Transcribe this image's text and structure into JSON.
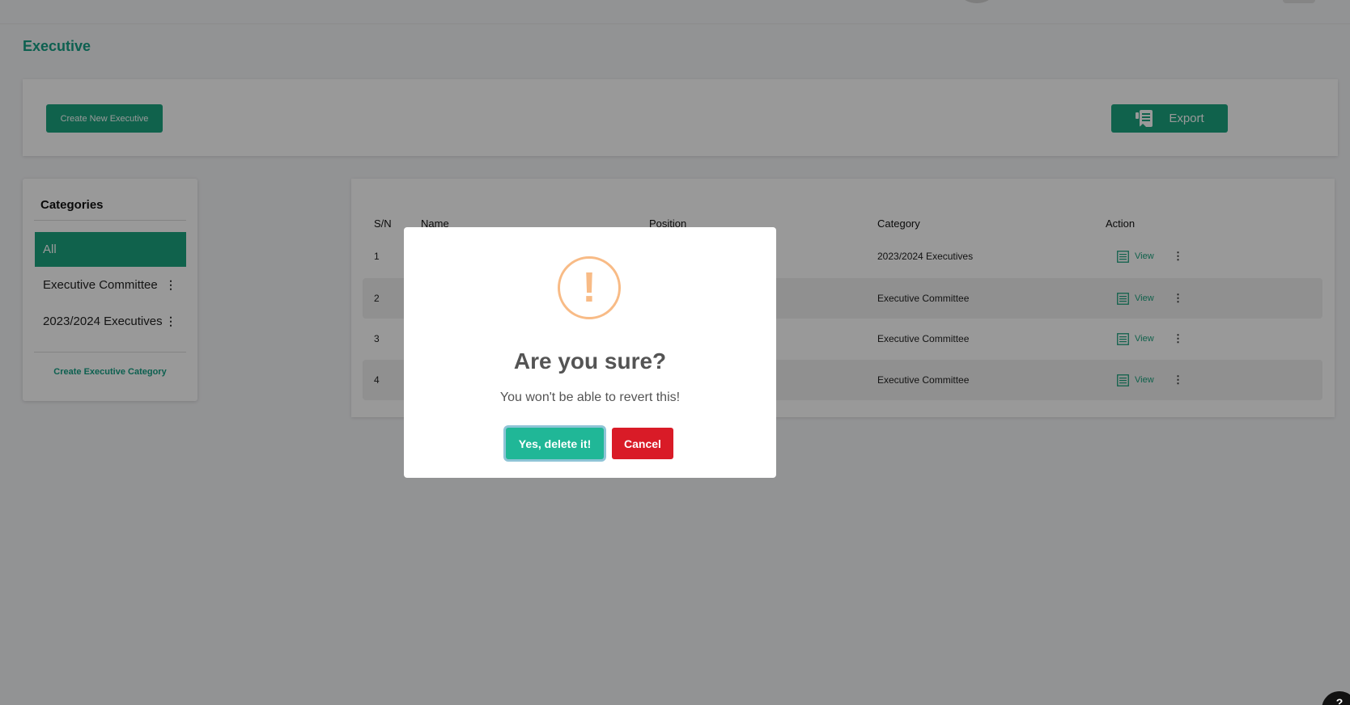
{
  "page": {
    "title": "Executive"
  },
  "toolbar": {
    "create_label": "Create New Executive",
    "export_label": "Export"
  },
  "categories": {
    "title": "Categories",
    "items": [
      {
        "label": "All",
        "active": true
      },
      {
        "label": "Executive Committee",
        "active": false
      },
      {
        "label": "2023/2024 Executives",
        "active": false
      }
    ],
    "create_label": "Create Executive Category"
  },
  "table": {
    "headers": [
      "S/N",
      "Name",
      "Position",
      "Category",
      "Action"
    ],
    "rows": [
      {
        "sn": "1",
        "category": "2023/2024 Executives",
        "action": "View"
      },
      {
        "sn": "2",
        "category": "Executive Committee",
        "action": "View"
      },
      {
        "sn": "3",
        "category": "Executive Committee",
        "action": "View"
      },
      {
        "sn": "4",
        "category": "Executive Committee",
        "action": "View"
      }
    ]
  },
  "dialog": {
    "icon": "!",
    "title": "Are you sure?",
    "text": "You won't be able to revert this!",
    "confirm_label": "Yes, delete it!",
    "cancel_label": "Cancel"
  },
  "help": {
    "icon": "?"
  },
  "colors": {
    "brand": "#1ca37f",
    "confirm": "#20b797",
    "cancel": "#d91b27",
    "warning": "#f8bb86"
  }
}
